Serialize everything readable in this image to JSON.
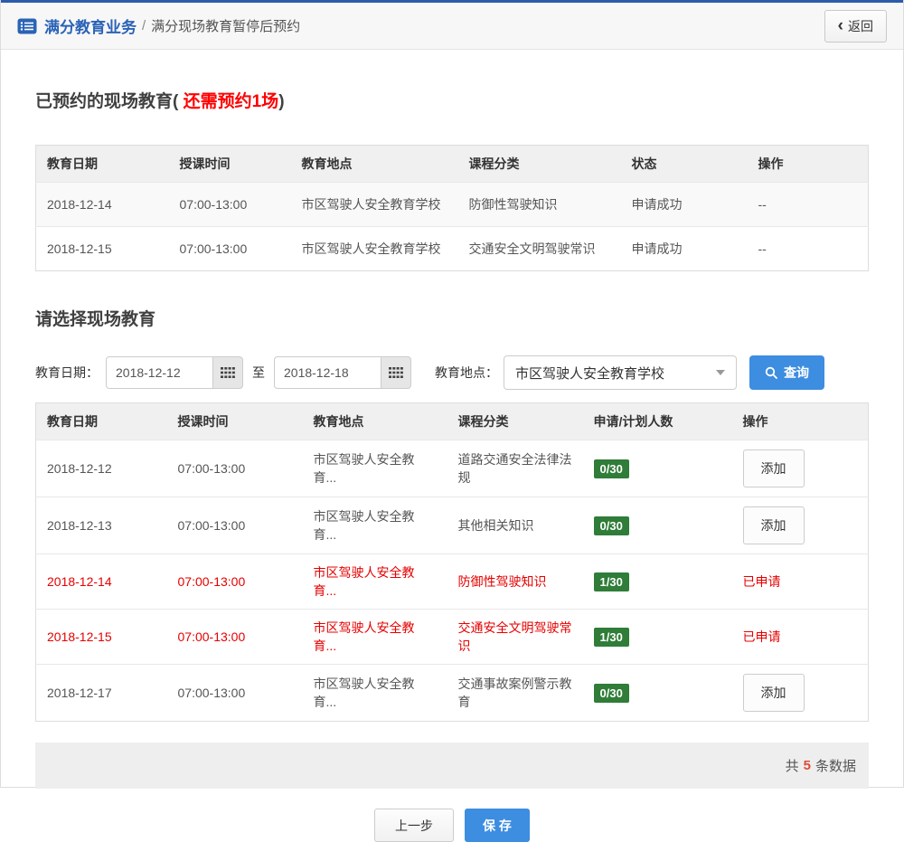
{
  "header": {
    "section": "满分教育业务",
    "separator": "/",
    "current": "满分现场教育暂停后预约",
    "back_chevron": "‹",
    "back_label": "返回"
  },
  "booked": {
    "title_prefix": "已预约的现场教育(",
    "title_highlight": " 还需预约1场",
    "title_suffix": ")",
    "columns": [
      "教育日期",
      "授课时间",
      "教育地点",
      "课程分类",
      "状态",
      "操作"
    ],
    "rows": [
      {
        "date": "2018-12-14",
        "time": "07:00-13:00",
        "location": "市区驾驶人安全教育学校",
        "category": "防御性驾驶知识",
        "status": "申请成功",
        "action": "--"
      },
      {
        "date": "2018-12-15",
        "time": "07:00-13:00",
        "location": "市区驾驶人安全教育学校",
        "category": "交通安全文明驾驶常识",
        "status": "申请成功",
        "action": "--"
      }
    ]
  },
  "select": {
    "title": "请选择现场教育",
    "filter": {
      "date_label": "教育日期：",
      "date_from": "2018-12-12",
      "to_label": "至",
      "date_to": "2018-12-18",
      "location_label": "教育地点：",
      "location_value": "市区驾驶人安全教育学校",
      "search_label": "查询"
    },
    "columns": [
      "教育日期",
      "授课时间",
      "教育地点",
      "课程分类",
      "申请/计划人数",
      "操作"
    ],
    "rows": [
      {
        "date": "2018-12-12",
        "time": "07:00-13:00",
        "location": "市区驾驶人安全教育...",
        "category": "道路交通安全法律法规",
        "quota": "0/30",
        "action": "添加"
      },
      {
        "date": "2018-12-13",
        "time": "07:00-13:00",
        "location": "市区驾驶人安全教育...",
        "category": "其他相关知识",
        "quota": "0/30",
        "action": "添加"
      },
      {
        "date": "2018-12-14",
        "time": "07:00-13:00",
        "location": "市区驾驶人安全教育...",
        "category": "防御性驾驶知识",
        "quota": "1/30",
        "action": "已申请"
      },
      {
        "date": "2018-12-15",
        "time": "07:00-13:00",
        "location": "市区驾驶人安全教育...",
        "category": "交通安全文明驾驶常识",
        "quota": "1/30",
        "action": "已申请"
      },
      {
        "date": "2018-12-17",
        "time": "07:00-13:00",
        "location": "市区驾驶人安全教育...",
        "category": "交通事故案例警示教育",
        "quota": "0/30",
        "action": "添加"
      }
    ],
    "footer": {
      "prefix": "共",
      "count": "5",
      "suffix": "条数据"
    }
  },
  "actions": {
    "prev": "上一步",
    "save": "保 存"
  },
  "colors": {
    "brand_blue": "#2a63b7",
    "accent_blue": "#3d8de0",
    "alert_red": "#e60000",
    "quota_green": "#2f7d38",
    "count_red": "#dd4b39"
  }
}
